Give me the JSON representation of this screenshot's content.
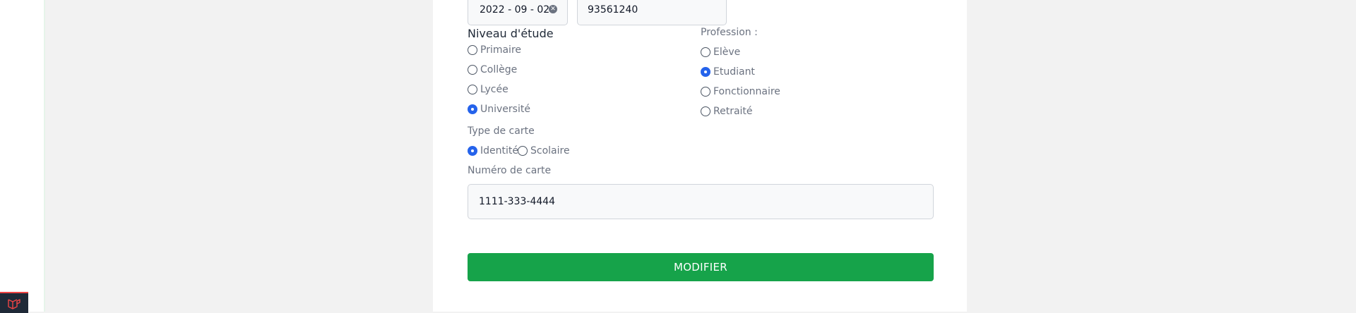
{
  "form": {
    "date_value": "2022 - 09 - 02",
    "phone_value": "93561240",
    "niveau": {
      "label": "Niveau d'étude",
      "options": [
        "Primaire",
        "Collège",
        "Lycée",
        "Université"
      ],
      "selected": "Université"
    },
    "profession": {
      "label": "Profession :",
      "options": [
        "Elève",
        "Etudiant",
        "Fonctionnaire",
        "Retraité"
      ],
      "selected": "Etudiant"
    },
    "type_carte": {
      "label": "Type de carte",
      "options": [
        "Identité",
        "Scolaire"
      ],
      "selected": "Identité"
    },
    "numero_carte": {
      "label": "Numéro de carte",
      "value": "1111-333-4444"
    },
    "submit_label": "MODIFIER"
  },
  "colors": {
    "accent": "#2563eb",
    "submit": "#16a34a",
    "debug_bar": "#1f2937",
    "debug_accent": "#ef4444"
  },
  "icons": [
    "clear-icon",
    "laravel-logo-icon"
  ]
}
